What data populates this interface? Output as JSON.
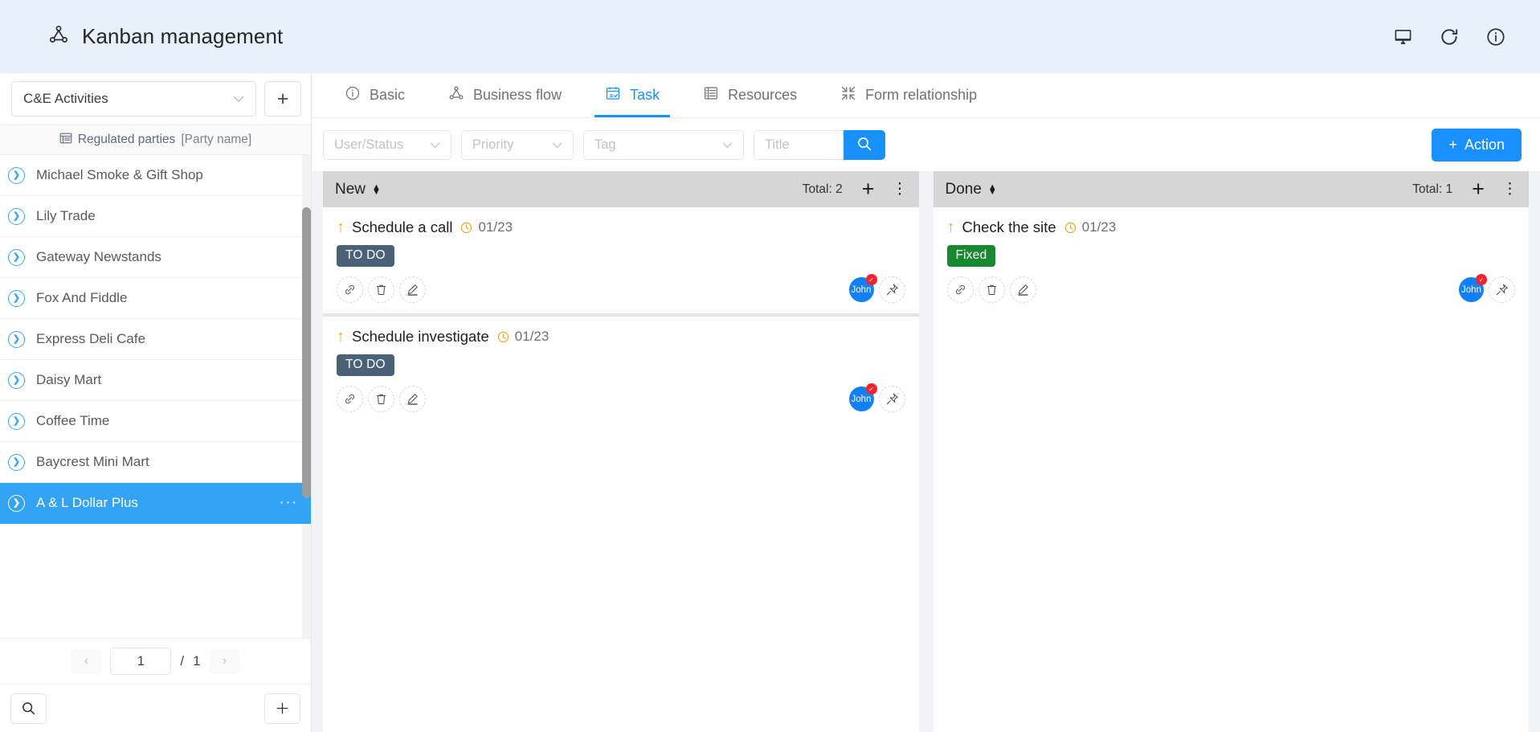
{
  "header": {
    "title": "Kanban management",
    "logo_icon": "hierarchy-node-icon",
    "actions": [
      {
        "icon": "monitor-icon",
        "name": "monitor"
      },
      {
        "icon": "refresh-icon",
        "name": "refresh"
      },
      {
        "icon": "info-icon",
        "name": "info"
      }
    ]
  },
  "sidebar": {
    "selector": {
      "value": "C&E Activities",
      "chevron": "⌄"
    },
    "add_button": "+",
    "subheader": {
      "label": "Regulated parties",
      "field": "[Party name]",
      "icon": "table-icon"
    },
    "items": [
      {
        "label": "Michael Smoke & Gift Shop",
        "selected": false
      },
      {
        "label": "Lily Trade",
        "selected": false
      },
      {
        "label": "Gateway Newstands",
        "selected": false
      },
      {
        "label": "Fox And Fiddle",
        "selected": false
      },
      {
        "label": "Express Deli Cafe",
        "selected": false
      },
      {
        "label": "Daisy Mart",
        "selected": false
      },
      {
        "label": "Coffee Time",
        "selected": false
      },
      {
        "label": "Baycrest Mini Mart",
        "selected": false
      },
      {
        "label": "A & L Dollar Plus",
        "selected": true,
        "more": "···"
      }
    ],
    "pager": {
      "prev": "‹",
      "current": "1",
      "separator": "/",
      "total": "1",
      "next": "›"
    },
    "footer": {
      "search_icon": "search-icon",
      "add_icon": "plus-icon"
    }
  },
  "tabs": [
    {
      "label": "Basic",
      "icon": "info-circle-icon",
      "active": false
    },
    {
      "label": "Business flow",
      "icon": "hierarchy-node-icon",
      "active": false
    },
    {
      "label": "Task",
      "icon": "calendar-check-icon",
      "active": true
    },
    {
      "label": "Resources",
      "icon": "list-panel-icon",
      "active": false
    },
    {
      "label": "Form relationship",
      "icon": "collapse-arrows-icon",
      "active": false
    }
  ],
  "filters": {
    "user_status": {
      "placeholder": "User/Status",
      "value": ""
    },
    "priority": {
      "placeholder": "Priority",
      "value": ""
    },
    "tag": {
      "placeholder": "Tag",
      "value": ""
    },
    "title": {
      "placeholder": "Title",
      "value": ""
    },
    "search_icon": "search-icon",
    "action_button": {
      "label": "Action",
      "plus": "+"
    }
  },
  "board": {
    "columns": [
      {
        "name": "New",
        "total_label": "Total: 2",
        "add": "+",
        "more": "⋮",
        "cards": [
          {
            "priority_icon": "arrow-up-icon",
            "title": "Schedule a call",
            "due_icon": "clock-icon",
            "due_date": "01/23",
            "tag": {
              "label": "TO DO",
              "color": "#4a6278"
            },
            "actions": [
              "link-icon",
              "trash-icon",
              "edit-pencil-icon"
            ],
            "assignee": {
              "name": "John",
              "color": "#1080ff",
              "badge": "✓"
            },
            "pin_icon": "pin-icon"
          },
          {
            "priority_icon": "arrow-up-icon",
            "title": "Schedule investigate",
            "due_icon": "clock-icon",
            "due_date": "01/23",
            "tag": {
              "label": "TO DO",
              "color": "#4a6278"
            },
            "actions": [
              "link-icon",
              "trash-icon",
              "edit-pencil-icon"
            ],
            "assignee": {
              "name": "John",
              "color": "#1080ff",
              "badge": "✓"
            },
            "pin_icon": "pin-icon"
          }
        ]
      },
      {
        "name": "Done",
        "total_label": "Total: 1",
        "add": "+",
        "more": "⋮",
        "cards": [
          {
            "priority_icon": "arrow-up-icon",
            "title": "Check the site",
            "due_icon": "clock-icon",
            "due_date": "01/23",
            "tag": {
              "label": "Fixed",
              "color": "#18892f"
            },
            "actions": [
              "link-icon",
              "trash-icon",
              "edit-pencil-icon"
            ],
            "assignee": {
              "name": "John",
              "color": "#1080ff",
              "badge": "✓"
            },
            "pin_icon": "pin-icon"
          }
        ]
      }
    ]
  },
  "colors": {
    "accent": "#1890ff",
    "topbar_bg": "#e8f0fb",
    "selected_row": "#32a3f5",
    "column_header_bg": "#d6d6d6",
    "priority_arrow": "#f6a51c"
  }
}
